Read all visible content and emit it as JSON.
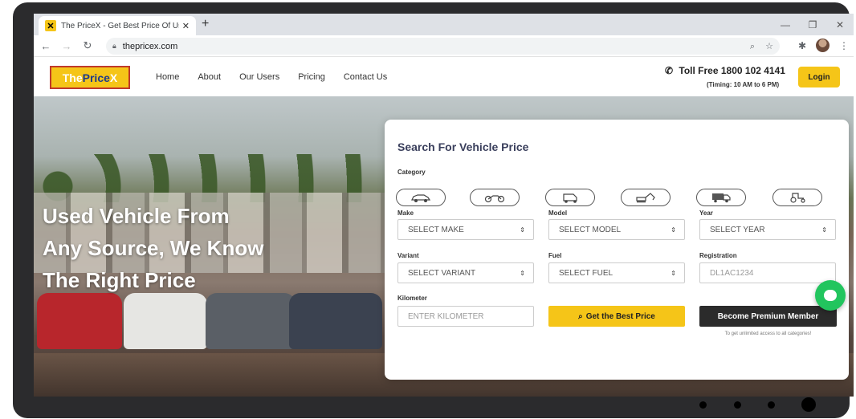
{
  "browser": {
    "tab_title": "The PriceX - Get Best Price Of Us",
    "tab_close": "✕",
    "new_tab": "+",
    "url": "thepricex.com",
    "window_min": "—",
    "window_max": "❐",
    "window_close": "✕"
  },
  "header": {
    "logo": {
      "the": "The ",
      "price": "Price",
      "x": "X"
    },
    "nav": [
      "Home",
      "About",
      "Our Users",
      "Pricing",
      "Contact Us"
    ],
    "toll_free": "Toll Free 1800 102 4141",
    "timing": "(Timing: 10 AM to 6 PM)",
    "login": "Login"
  },
  "hero": {
    "headline_lines": [
      "Used Vehicle From",
      "Any Source, We Know",
      "The Right Price"
    ]
  },
  "search": {
    "title": "Search For Vehicle Price",
    "category_label": "Category",
    "categories": [
      "car-icon",
      "motorcycle-icon",
      "auto-rickshaw-icon",
      "excavator-icon",
      "truck-icon",
      "tractor-icon"
    ],
    "make_label": "Make",
    "make_placeholder": "SELECT MAKE",
    "model_label": "Model",
    "model_placeholder": "SELECT MODEL",
    "year_label": "Year",
    "year_placeholder": "SELECT YEAR",
    "variant_label": "Variant",
    "variant_placeholder": "SELECT VARIANT",
    "fuel_label": "Fuel",
    "fuel_placeholder": "SELECT FUEL",
    "registration_label": "Registration",
    "registration_placeholder": "DL1AC1234",
    "kilometer_label": "Kilometer",
    "kilometer_placeholder": "ENTER KILOMETER",
    "best_price_button": "Get the Best Price",
    "premium_button": "Become Premium Member",
    "premium_note": "To get unlimited access to all categories!"
  },
  "colors": {
    "accent": "#f5c518",
    "dark": "#2b2b2b",
    "chat": "#22c55e"
  }
}
